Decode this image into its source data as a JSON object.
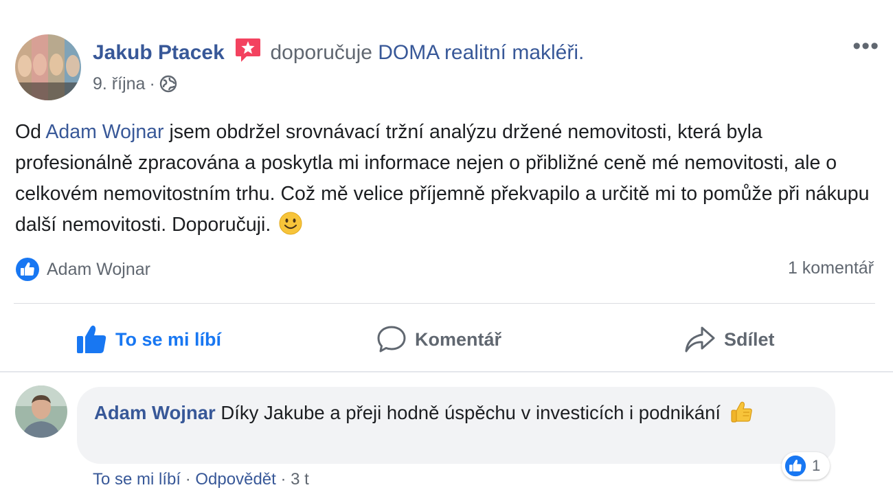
{
  "post": {
    "author": "Jakub Ptacek",
    "verb": "doporučuje",
    "page": "DOMA realitní makléři.",
    "date": "9. října",
    "dot": "·",
    "more": "•••",
    "text": {
      "prefix": "Od",
      "mention": "Adam Wojnar",
      "body": "jsem obdržel srovnávací tržní analýzu držené nemovitosti, která byla profesionálně zpracována a poskytla mi informace nejen o přibližné ceně mé nemovitosti, ale o celkovém nemovitostním trhu. Což mě velice příjemně překvapilo a určitě mi to pomůže při nákupu další nemovitosti. Doporučuji."
    },
    "reaction_name": "Adam Wojnar",
    "comments_count": "1 komentář"
  },
  "actions": {
    "like": "To se mi líbí",
    "comment": "Komentář",
    "share": "Sdílet"
  },
  "comment": {
    "author": "Adam Wojnar",
    "text": "Díky Jakube a přeji hodně úspěchu v investicích i podnikání",
    "like": "To se mi líbí",
    "sep": "·",
    "reply": "Odpovědět",
    "time": "3 t",
    "reaction_count": "1"
  },
  "colors": {
    "link": "#385898",
    "accent": "#1877f2",
    "muted": "#606770",
    "bubble": "#f2f3f5",
    "badge": "#f3425f"
  }
}
